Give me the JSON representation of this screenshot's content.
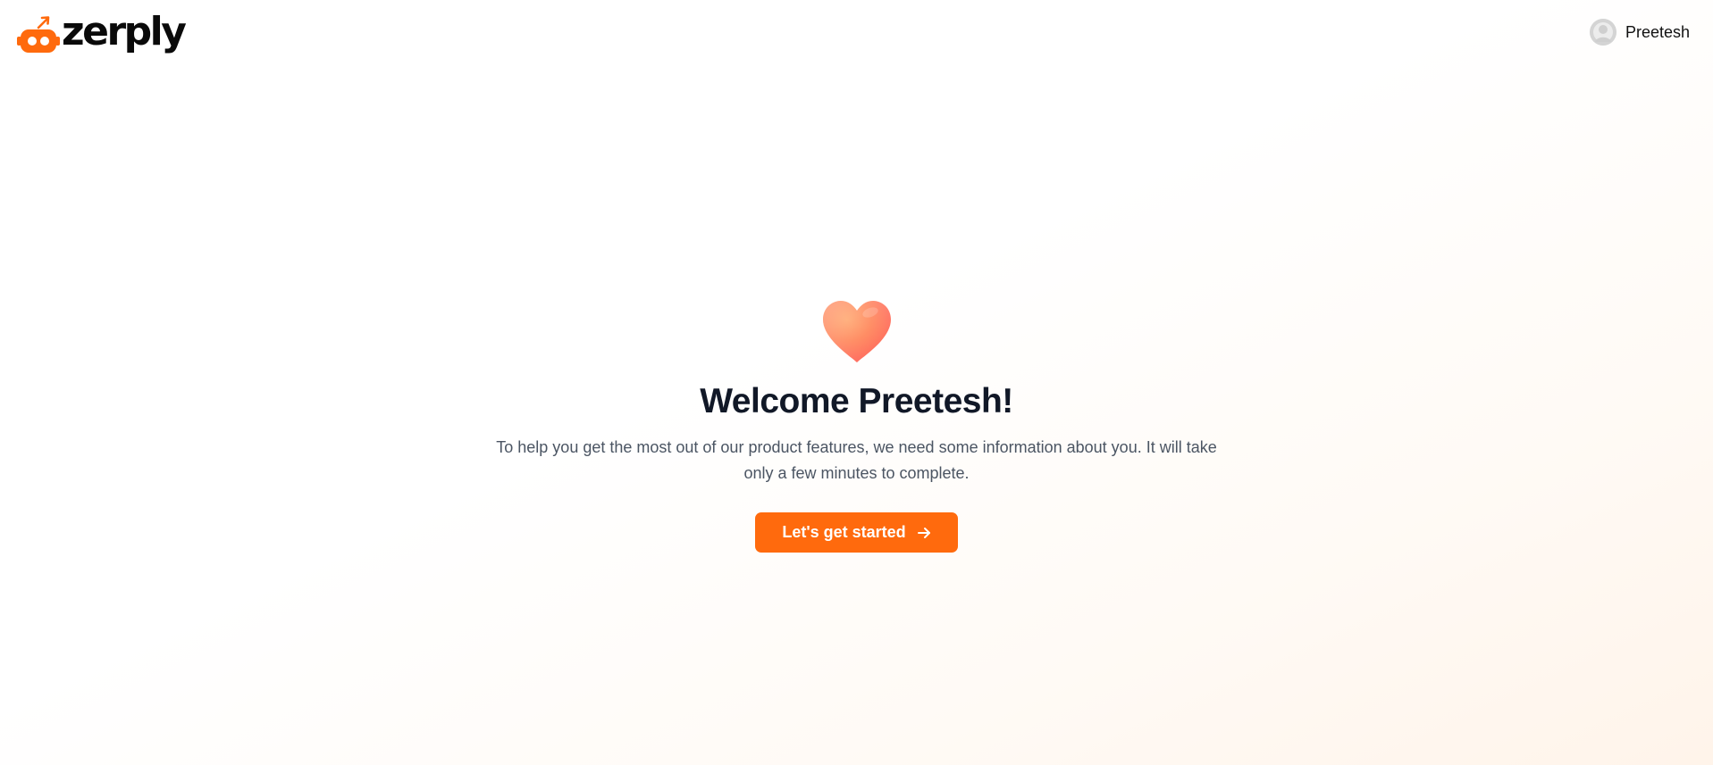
{
  "brand": {
    "name": "zerply",
    "accent_color": "#ff6a0d"
  },
  "header": {
    "user_name": "Preetesh",
    "avatar_icon": "user-avatar-placeholder"
  },
  "welcome": {
    "icon": "heart-icon",
    "title": "Welcome Preetesh!",
    "description": "To help you get the most out of our product features, we need some information about you. It will take only a few minutes to complete.",
    "cta_label": "Let's get started",
    "cta_icon": "arrow-right-icon"
  }
}
